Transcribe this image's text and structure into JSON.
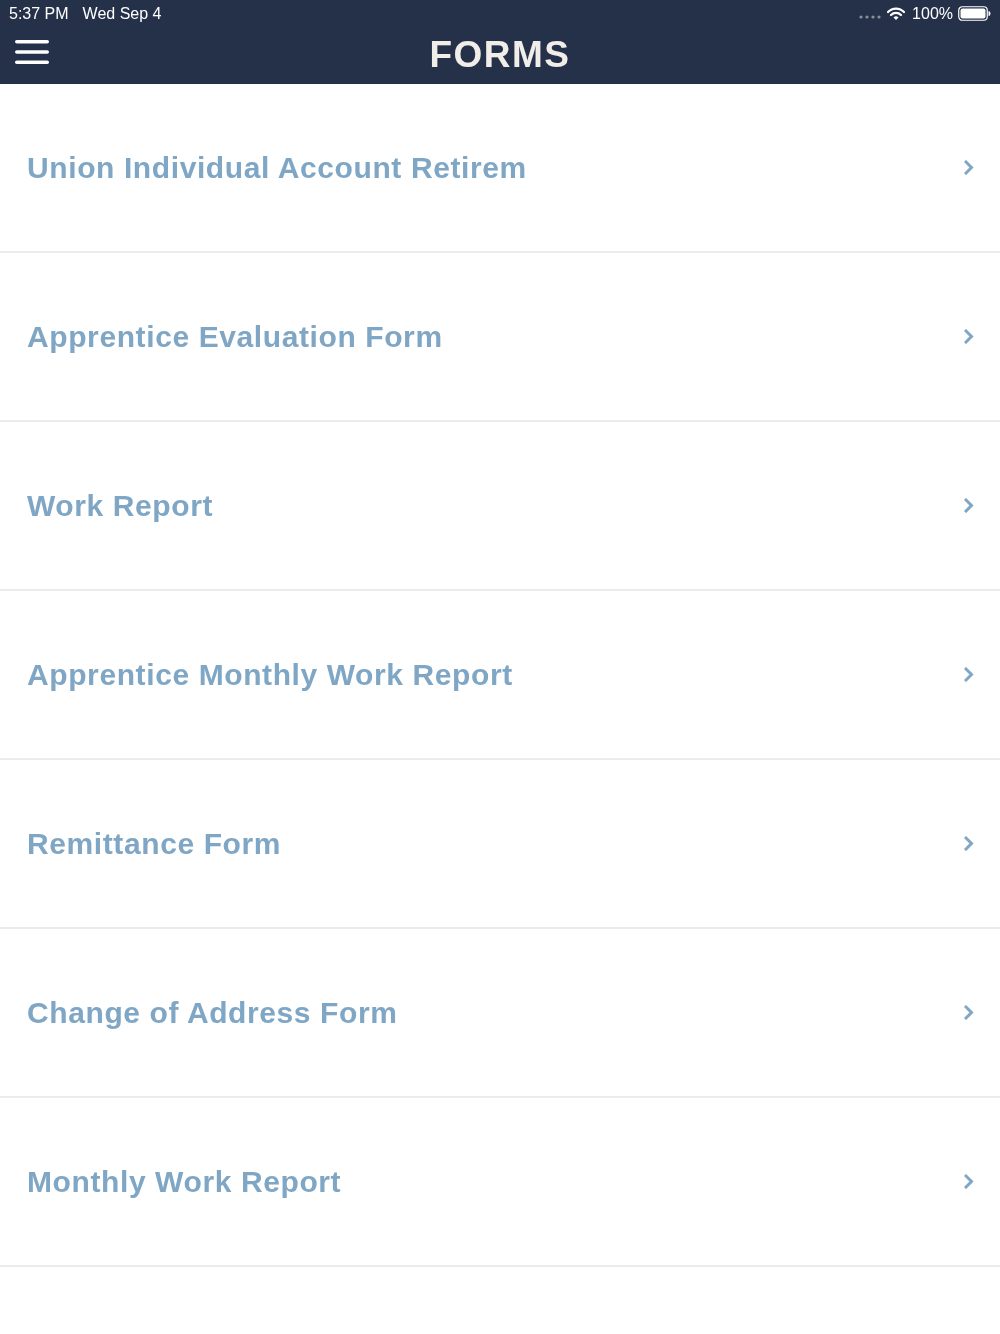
{
  "status_bar": {
    "time": "5:37 PM",
    "date": "Wed Sep 4",
    "battery": "100%"
  },
  "header": {
    "title": "FORMS"
  },
  "forms": [
    {
      "title": "Union Individual Account Retirem"
    },
    {
      "title": "Apprentice Evaluation Form"
    },
    {
      "title": "Work Report"
    },
    {
      "title": "Apprentice Monthly Work Report"
    },
    {
      "title": "Remittance Form"
    },
    {
      "title": "Change of Address Form"
    },
    {
      "title": "Monthly Work Report"
    }
  ]
}
